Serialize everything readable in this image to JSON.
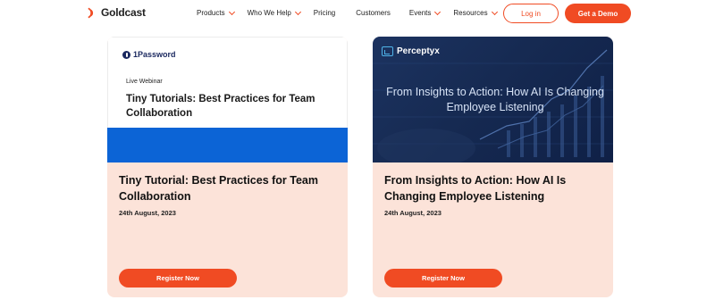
{
  "brand": {
    "name": "Goldcast",
    "accent": "#f04b23"
  },
  "nav": {
    "items": [
      {
        "label": "Products",
        "has_dropdown": true
      },
      {
        "label": "Who We Help",
        "has_dropdown": true
      },
      {
        "label": "Pricing",
        "has_dropdown": false
      },
      {
        "label": "Customers",
        "has_dropdown": false
      },
      {
        "label": "Events",
        "has_dropdown": true
      },
      {
        "label": "Resources",
        "has_dropdown": true
      }
    ],
    "login_label": "Log in",
    "demo_label": "Get a Demo"
  },
  "cards": [
    {
      "thumbnail": {
        "logo_text": "1Password",
        "kicker": "Live Webinar",
        "title": "Tiny Tutorials: Best Practices for Team Collaboration",
        "colors": {
          "top": "#ffffff",
          "band": "#0c64d6"
        }
      },
      "title": "Tiny Tutorial: Best Practices for Team Collaboration",
      "date": "24th August, 2023",
      "button_label": "Register Now"
    },
    {
      "thumbnail": {
        "logo_text": "Perceptyx",
        "title": "From Insights to Action: How AI Is Changing Employee Listening",
        "colors": {
          "background": "#162a52"
        }
      },
      "title": "From Insights to Action: How AI Is Changing Employee Listening",
      "date": "24th August, 2023",
      "button_label": "Register Now"
    }
  ]
}
